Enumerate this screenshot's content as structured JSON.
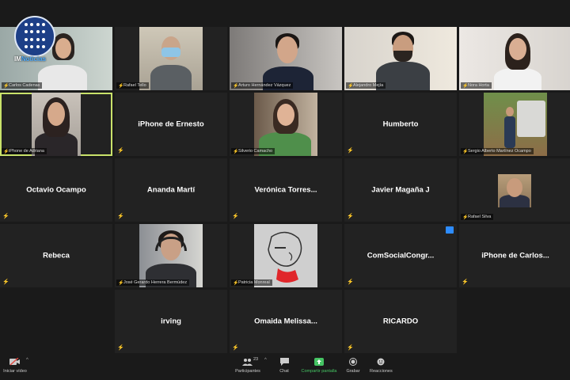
{
  "meeting": {
    "logo_text_a": "IM",
    "logo_text_b": "Noticias"
  },
  "tiles": [
    {
      "name": "Carlos Cadenas"
    },
    {
      "name": "Rafael Tello"
    },
    {
      "name": "Arturo Hernández Vázquez"
    },
    {
      "name": "Alejandro Mejía"
    },
    {
      "name": "Nora Horta"
    },
    {
      "name": "iPhone de Adriana"
    },
    {
      "display": "iPhone de Ernesto"
    },
    {
      "name": "Silverio Camacho"
    },
    {
      "display": "Humberto"
    },
    {
      "name": "Sergio Alberto Martínez Ocampo"
    },
    {
      "display": "Octavio Ocampo"
    },
    {
      "display": "Ananda Martí"
    },
    {
      "display": "Verónica  Torres..."
    },
    {
      "display": "Javier Magaña J"
    },
    {
      "name": "Rafael Silva"
    },
    {
      "display": "Rebeca"
    },
    {
      "name": "José Gerardo Herrera Bermúdez"
    },
    {
      "name": "Patricia Monreal"
    },
    {
      "display": "ComSocialCongr..."
    },
    {
      "display": "iPhone  de Carlos..."
    },
    {
      "display": "irving"
    },
    {
      "display": "Omaida  Melissa..."
    },
    {
      "display": "RICARDO"
    }
  ],
  "toolbar": {
    "start_video": "Iniciar vídeo",
    "participants": "Participantes",
    "participant_count": "23",
    "chat": "Chat",
    "share_screen": "Compartir pantalla",
    "record": "Grabar",
    "reactions": "Reacciones"
  },
  "colors": {
    "tile_bg": "#222222",
    "active_border": "#c9e26a",
    "share_green": "#45c463",
    "mute_red": "#e0463e"
  }
}
